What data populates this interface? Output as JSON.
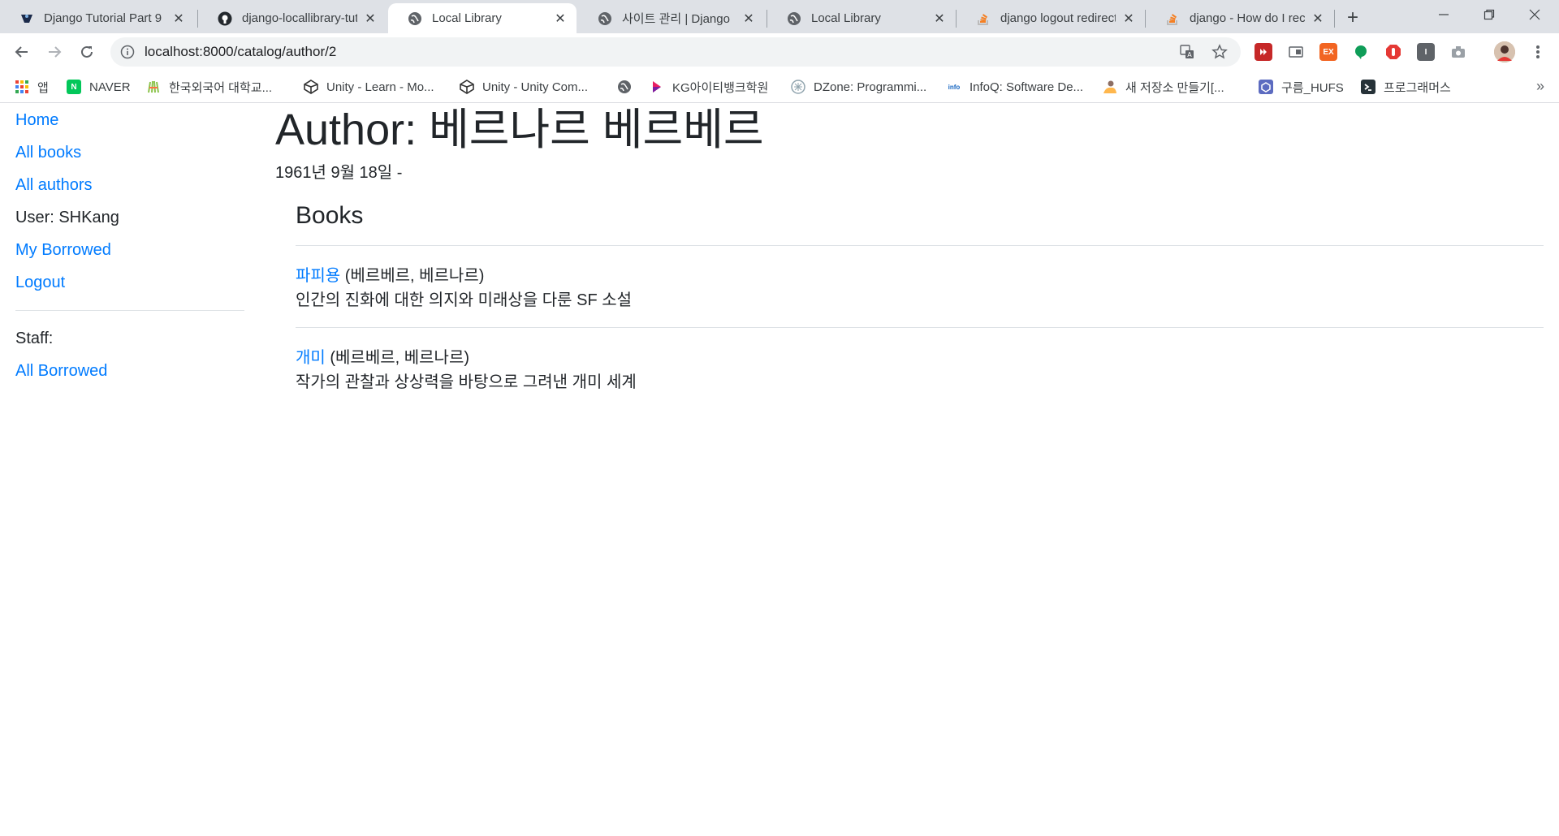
{
  "browser": {
    "tabs": [
      {
        "title": "Django Tutorial Part 9",
        "icon": "django-mdn-icon"
      },
      {
        "title": "django-locallibrary-tut",
        "icon": "github-icon"
      },
      {
        "title": "Local Library",
        "icon": "globe-icon",
        "active": true
      },
      {
        "title": "사이트 관리 | Django",
        "icon": "globe-icon"
      },
      {
        "title": "Local Library",
        "icon": "globe-icon"
      },
      {
        "title": "django logout redirect",
        "icon": "stackoverflow-icon"
      },
      {
        "title": "django - How do I rec",
        "icon": "stackoverflow-icon"
      }
    ],
    "url": "localhost:8000/catalog/author/2",
    "bookmarks": [
      {
        "label": "앱",
        "icon": "apps-grid-icon"
      },
      {
        "label": "NAVER",
        "icon": "naver-icon"
      },
      {
        "label": "한국외국어 대학교...",
        "icon": "hufs-icon"
      },
      {
        "label": "Unity - Learn - Mo...",
        "icon": "unity-icon"
      },
      {
        "label": "Unity - Unity Com...",
        "icon": "unity-icon"
      },
      {
        "label": "",
        "icon": "globe-icon"
      },
      {
        "label": "KG아이티뱅크학원",
        "icon": "kg-icon"
      },
      {
        "label": "DZone: Programmi...",
        "icon": "dzone-icon"
      },
      {
        "label": "InfoQ: Software De...",
        "icon": "infoq-icon"
      },
      {
        "label": "새 저장소 만들기[...",
        "icon": "folder-person-icon"
      },
      {
        "label": "구름_HUFS",
        "icon": "goorm-icon"
      },
      {
        "label": "프로그래머스",
        "icon": "programmers-icon"
      }
    ],
    "more_label": "»",
    "ext_ex_label": "EX",
    "ext_i_label": "I"
  },
  "sidebar": {
    "home": "Home",
    "all_books": "All books",
    "all_authors": "All authors",
    "user": "User: SHKang",
    "my_borrowed": "My Borrowed",
    "logout": "Logout",
    "staff": "Staff:",
    "all_borrowed": "All Borrowed"
  },
  "main": {
    "title": "Author: 베르나르 베르베르",
    "dates": "1961년 9월 18일 -",
    "books_heading": "Books",
    "books": [
      {
        "title": "파피용",
        "author": " (베르베르, 베르나르)",
        "summary": "인간의 진화에 대한 의지와 미래상을 다룬 SF 소설"
      },
      {
        "title": "개미",
        "author": " (베르베르, 베르나르)",
        "summary": "작가의 관찰과 상상력을 바탕으로 그려낸 개미 세계"
      }
    ]
  },
  "colors": {
    "link": "#007bff",
    "text": "#212529",
    "chrome_bg": "#dee1e6"
  }
}
